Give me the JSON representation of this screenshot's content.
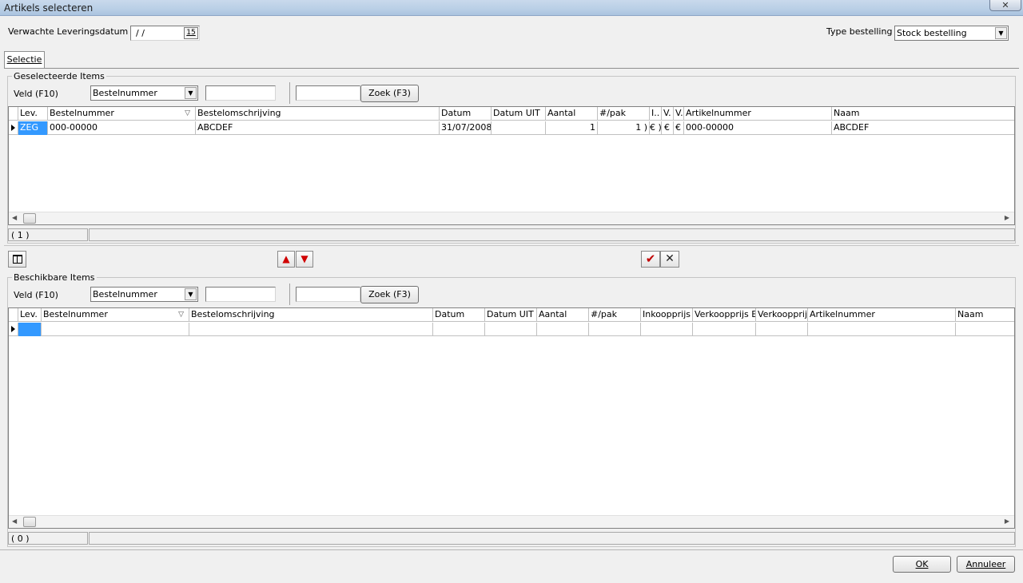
{
  "window": {
    "title": "Artikels selecteren",
    "close_glyph": "✕"
  },
  "header": {
    "delivery_label": "Verwachte Leveringsdatum",
    "delivery_value": " / /",
    "calendar_glyph": "15",
    "type_label": "Type bestelling",
    "type_value": "Stock bestelling"
  },
  "tabs": [
    {
      "label": "Selectie"
    }
  ],
  "selected": {
    "group_title": "Geselecteerde Items",
    "field_label": "Veld (F10)",
    "field_value": "Bestelnummer",
    "search_button": "Zoek (F3)",
    "columns": [
      "Lev.",
      "Bestelnummer",
      "Bestelomschrijving",
      "Datum",
      "Datum UIT",
      "Aantal",
      "#/pak",
      "I..",
      "V.",
      "V.",
      "Artikelnummer",
      "Naam"
    ],
    "rows": [
      {
        "lev": "ZEG",
        "bestelnummer": "000-00000",
        "omschrijving": "ABCDEF",
        "datum": "31/07/2008",
        "datum_uit": "",
        "aantal": "1",
        "pak": "1 )",
        "i": "€ )",
        "v1": "€",
        "v2": "€",
        "artikelnummer": "000-00000",
        "naam": "ABCDEF"
      }
    ],
    "count": "( 1 )"
  },
  "toolbar": {
    "move_up_glyph": "▲",
    "move_down_glyph": "▼",
    "accept_glyph": "✔",
    "reject_glyph": "✕"
  },
  "available": {
    "group_title": "Beschikbare Items",
    "field_label": "Veld (F10)",
    "field_value": "Bestelnummer",
    "search_button": "Zoek (F3)",
    "columns": [
      "Lev.",
      "Bestelnummer",
      "Bestelomschrijving",
      "Datum",
      "Datum UIT",
      "Aantal",
      "#/pak",
      "Inkoopprijs",
      "Verkoopprijs Ex",
      "Verkoopprijs",
      "Artikelnummer",
      "Naam"
    ],
    "count": "( 0 )"
  },
  "footer": {
    "ok": "OK",
    "cancel": "Annuleer"
  },
  "sort_glyph": "▽",
  "colors": {
    "selection": "#3399ff",
    "arrow_red": "#d00000",
    "check_red": "#c00000"
  }
}
